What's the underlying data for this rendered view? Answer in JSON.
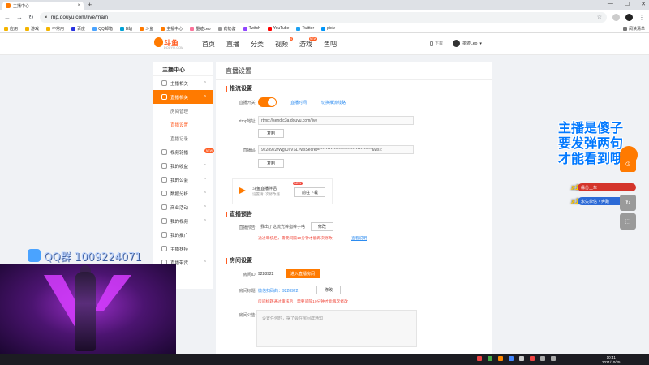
{
  "browser": {
    "tab_title": "主播中心",
    "tab_close": "×",
    "new_tab": "+",
    "window_controls": [
      "—",
      "☐",
      "✕"
    ],
    "url": "mp.douyu.com/live/main",
    "bookmarks": [
      "应用",
      "游戏",
      "不常用",
      "百度",
      "QQ邮箱",
      "B站",
      "斗鱼",
      "主播中心",
      "墨迹Leo",
      "药奶酱",
      "Twitch",
      "YouTube",
      "Twitter",
      "pixiv"
    ],
    "bookmarks_right": "阅读清单"
  },
  "site": {
    "logo_text": "斗鱼",
    "logo_sub": "DOUYU.COM",
    "nav": [
      {
        "label": "首页"
      },
      {
        "label": "直播"
      },
      {
        "label": "分类"
      },
      {
        "label": "视频",
        "badge": "4"
      },
      {
        "label": "游戏",
        "badge": "NEW"
      },
      {
        "label": "鱼吧"
      }
    ],
    "download": "下载",
    "username": "墨迹Leo",
    "user_chevron": "▾"
  },
  "sidebar": {
    "title": "主播中心",
    "items": [
      {
        "label": "主播相关",
        "chev": "^"
      },
      {
        "label": "直播相关",
        "chev": "^",
        "active": true
      },
      {
        "label": "房间管理",
        "sub": true
      },
      {
        "label": "直播设置",
        "sub": true,
        "active": true
      },
      {
        "label": "直播记录",
        "sub": true
      },
      {
        "label": "视频轮播",
        "badge": "NEW"
      },
      {
        "label": "我的收益",
        "chev": "^"
      },
      {
        "label": "我的公会",
        "chev": "^"
      },
      {
        "label": "数据分析",
        "chev": "^"
      },
      {
        "label": "商业活动",
        "chev": "^"
      },
      {
        "label": "我的视频",
        "chev": "^"
      },
      {
        "label": "我的推广"
      },
      {
        "label": "主播扶持"
      },
      {
        "label": "直播带货",
        "chev": "^"
      }
    ]
  },
  "content": {
    "page_title": "直播设置",
    "push": {
      "title": "推流设置",
      "switch_label": "直播开关:",
      "switch_on": true,
      "live_time_link": "直播时间",
      "switch_region_link": "切换推流线路",
      "rtmp_label": "rtmp地址:",
      "rtmp_value": "rtmp://sendtc3a.douyu.com/live",
      "copy_button": "复制",
      "code_label": "直播码:",
      "code_value": "9228922rWgIUiIVSL?wsSecret=*********************************&wsT:",
      "copy_button_2": "复制"
    },
    "promo": {
      "title": "斗鱼直播伴侣",
      "badge": "NEW",
      "subtitle": "设置请1次修改器",
      "button": "前往下载"
    },
    "preview": {
      "title": "直播预告",
      "label": "直播预告:",
      "value": "我出了这流光棒指棒子啥",
      "edit_button": "修改",
      "note": "通过审核后，需要间隔10分钟才能再次修改",
      "note_link": "查看说明"
    },
    "room": {
      "title": "房间设置",
      "id_label": "房间ID:",
      "id_value": "9228922",
      "id_button": "进入直播房间",
      "title_label": "房间标题:",
      "title_value": "微信扫码的：9228922",
      "title_edit": "修改",
      "title_note": "房间标题通过审核后，需要间隔10分钟才能再次修改",
      "notice_label": "房间公告:",
      "notice_placeholder": "设置任何时，摆了会在房间群通知"
    }
  },
  "overlay": {
    "text": "主播是傻子\n要发弹两句\n才能看到哦",
    "gift_rows": [
      {
        "count": "x1",
        "label": "缘份上车"
      },
      {
        "count": "x1",
        "label": "永失挚信・奔跑"
      }
    ],
    "qq_text": "QQ群 1009224071"
  },
  "taskbar": {
    "time": "10:41",
    "date": "2021/10/25"
  },
  "colors": {
    "accent": "#ff7a00",
    "brand_red": "#ff5d23",
    "link": "#2d8cf0",
    "warning": "#f04a3e"
  }
}
